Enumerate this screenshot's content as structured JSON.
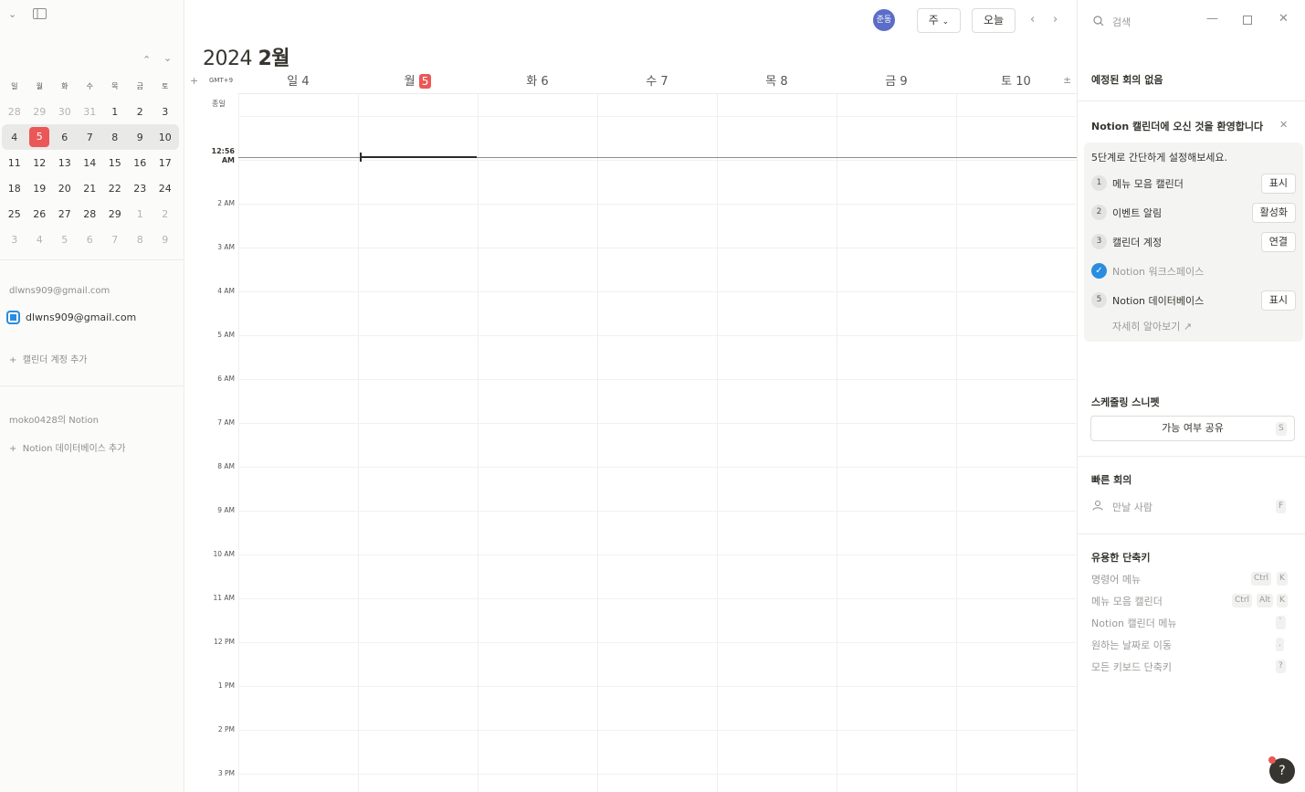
{
  "sidebar": {
    "mini_calendar": {
      "weekdays": [
        "일",
        "월",
        "화",
        "수",
        "목",
        "금",
        "토"
      ],
      "weeks": [
        [
          "28",
          "29",
          "30",
          "31",
          "1",
          "2",
          "3"
        ],
        [
          "4",
          "5",
          "6",
          "7",
          "8",
          "9",
          "10"
        ],
        [
          "11",
          "12",
          "13",
          "14",
          "15",
          "16",
          "17"
        ],
        [
          "18",
          "19",
          "20",
          "21",
          "22",
          "23",
          "24"
        ],
        [
          "25",
          "26",
          "27",
          "28",
          "29",
          "1",
          "2"
        ],
        [
          "3",
          "4",
          "5",
          "6",
          "7",
          "8",
          "9"
        ]
      ]
    },
    "account_header": "dlwns909@gmail.com",
    "account_calendar": "dlwns909@gmail.com",
    "add_calendar_account": "캘린더 계정 추가",
    "notion_workspace_header": "moko0428의 Notion",
    "add_notion_database": "Notion 데이터베이스 추가"
  },
  "header": {
    "year": "2024",
    "month": "2월",
    "avatar_text": "준동",
    "view_select": "주",
    "today_button": "오늘",
    "timezone": "GMT+9",
    "all_day": "종일",
    "days": [
      {
        "dow": "일",
        "num": "4",
        "today": false
      },
      {
        "dow": "월",
        "num": "5",
        "today": true
      },
      {
        "dow": "화",
        "num": "6",
        "today": false
      },
      {
        "dow": "수",
        "num": "7",
        "today": false
      },
      {
        "dow": "목",
        "num": "8",
        "today": false
      },
      {
        "dow": "금",
        "num": "9",
        "today": false
      },
      {
        "dow": "토",
        "num": "10",
        "today": false
      }
    ]
  },
  "time_grid": {
    "now_label": "12:56",
    "now_suffix": "AM",
    "hours": [
      "2 AM",
      "3 AM",
      "4 AM",
      "5 AM",
      "6 AM",
      "7 AM",
      "8 AM",
      "9 AM",
      "10 AM",
      "11 AM",
      "12 PM",
      "1 PM",
      "2 PM",
      "3 PM"
    ]
  },
  "right_panel": {
    "search_placeholder": "검색",
    "no_meetings": "예정된 회의 없음",
    "welcome_title": "Notion 캘린더에 오신 것을 환영합니다",
    "setup_intro": "5단계로 간단하게 설정해보세요.",
    "steps": [
      {
        "num": "1",
        "label": "메뉴 모음 캘린더",
        "action": "표시",
        "done": false
      },
      {
        "num": "2",
        "label": "이벤트 알림",
        "action": "활성화",
        "done": false
      },
      {
        "num": "3",
        "label": "캘린더 계정",
        "action": "연결",
        "done": false
      },
      {
        "num": "",
        "label": "Notion 워크스페이스",
        "action": "",
        "done": true
      },
      {
        "num": "5",
        "label": "Notion 데이터베이스",
        "action": "표시",
        "done": false
      }
    ],
    "learn_more": "자세히 알아보기",
    "scheduling_title": "스케줄링 스니펫",
    "share_availability": "가능 여부 공유",
    "share_key": "S",
    "quick_meeting_title": "빠른 회의",
    "meet_person": "만날 사람",
    "meet_key": "F",
    "shortcuts_title": "유용한 단축키",
    "shortcuts": [
      {
        "label": "명령어 메뉴",
        "keys": [
          "Ctrl",
          "K"
        ]
      },
      {
        "label": "메뉴 모음 캘린더",
        "keys": [
          "Ctrl",
          "Alt",
          "K"
        ]
      },
      {
        "label": "Notion 캘린더 메뉴",
        "keys": [
          "`"
        ]
      },
      {
        "label": "원하는 날짜로 이동",
        "keys": [
          "."
        ]
      },
      {
        "label": "모든 키보드 단축키",
        "keys": [
          "?"
        ]
      }
    ],
    "help": "?"
  }
}
